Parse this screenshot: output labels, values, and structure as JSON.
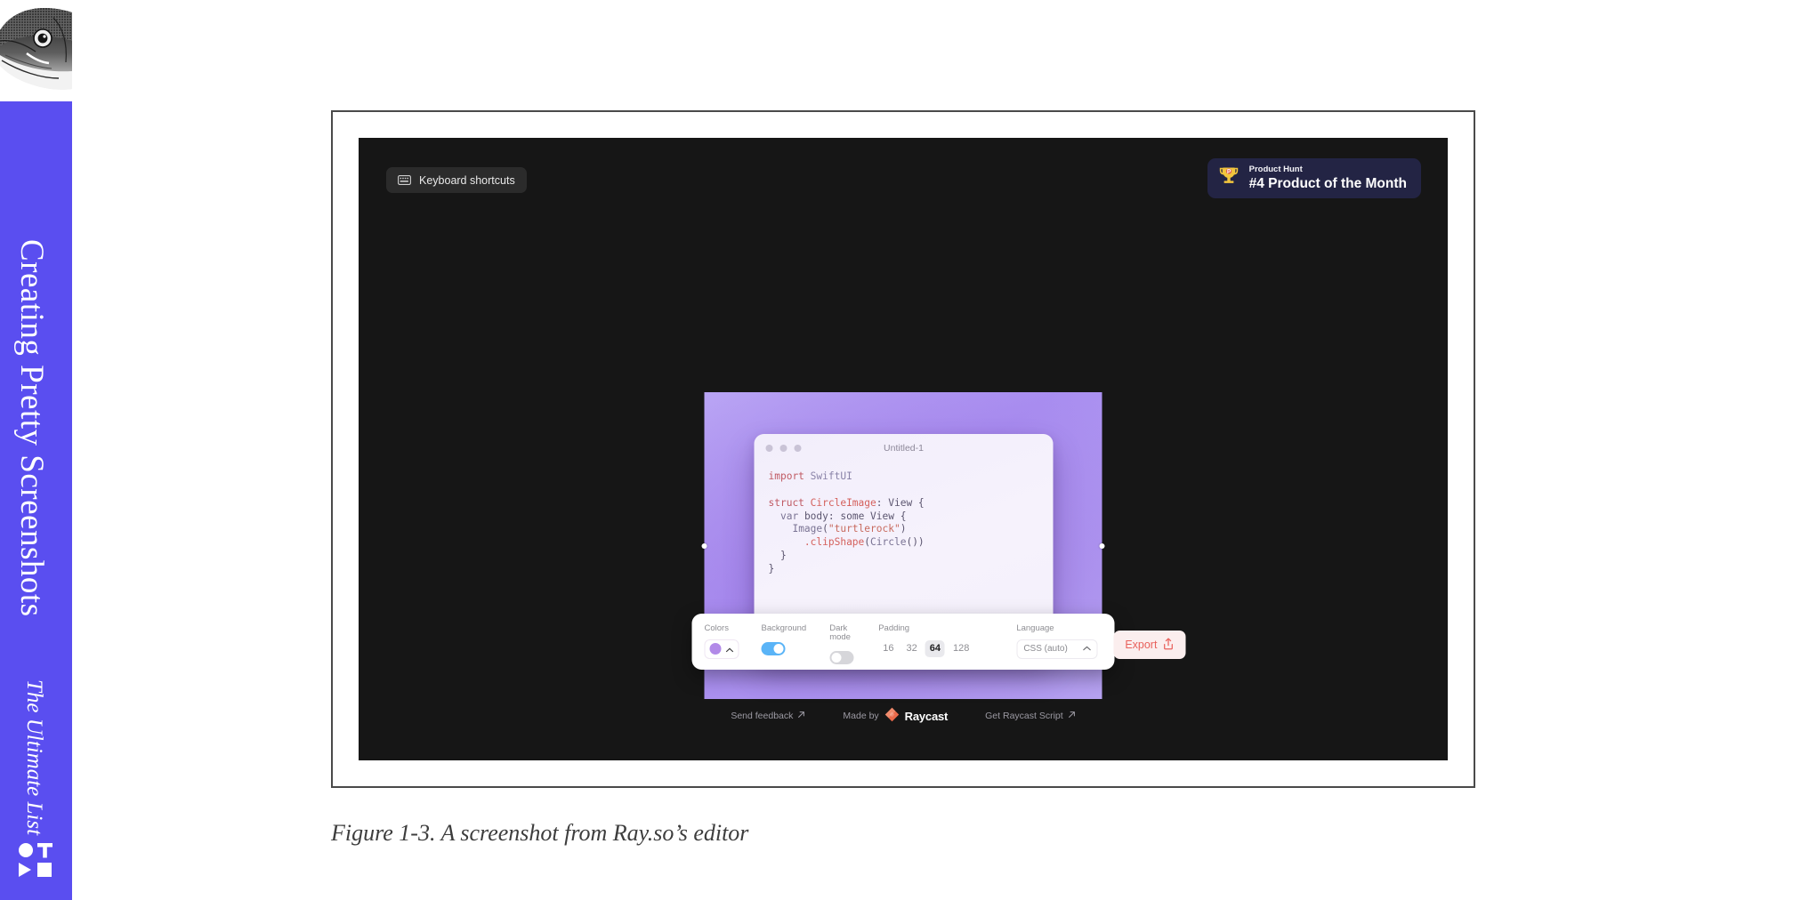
{
  "book": {
    "title": "Creating Pretty Screenshots",
    "subtitle": "The Ultimate List",
    "band_color": "#5a4ef0",
    "fish_icon": "fish-head-engraving-icon",
    "publisher_logo_icon": "publisher-shapes-logo-icon"
  },
  "caption": {
    "text": "Figure 1-3. A screenshot from Ray.so’s editor"
  },
  "app": {
    "background_color": "#161616",
    "keyboard_shortcuts": {
      "label": "Keyboard shortcuts",
      "icon": "keyboard-icon"
    },
    "product_hunt": {
      "label": "Product Hunt",
      "rank": "#4 Product of the Month",
      "icon": "trophy-icon",
      "badge_color": "#232444"
    }
  },
  "snippet": {
    "gradient_from": "#b9a4f4",
    "gradient_to": "#a98ef0",
    "window_title": "Untitled-1",
    "traffic_dots": [
      "dot-1",
      "dot-2",
      "dot-3"
    ],
    "code_lines": [
      [
        {
          "t": "import ",
          "c": "tok-kw"
        },
        {
          "t": "SwiftUI",
          "c": "tok-type"
        }
      ],
      [],
      [
        {
          "t": "struct ",
          "c": "tok-kw"
        },
        {
          "t": "CircleImage",
          "c": "tok-fn"
        },
        {
          "t": ": ",
          "c": "tok-pln"
        },
        {
          "t": "View",
          "c": "tok-pln"
        },
        {
          "t": " {",
          "c": "tok-pln"
        }
      ],
      [
        {
          "t": "  ",
          "c": "tok-pln"
        },
        {
          "t": "var",
          "c": "tok-id"
        },
        {
          "t": " body: ",
          "c": "tok-pln"
        },
        {
          "t": "some",
          "c": "tok-pln"
        },
        {
          "t": " View {",
          "c": "tok-pln"
        }
      ],
      [
        {
          "t": "    ",
          "c": "tok-pln"
        },
        {
          "t": "Image",
          "c": "tok-id"
        },
        {
          "t": "(",
          "c": "tok-pln"
        },
        {
          "t": "\"turtlerock\"",
          "c": "tok-str"
        },
        {
          "t": ")",
          "c": "tok-pln"
        }
      ],
      [
        {
          "t": "      ",
          "c": "tok-pln"
        },
        {
          "t": ".clipShape",
          "c": "tok-fn"
        },
        {
          "t": "(",
          "c": "tok-pln"
        },
        {
          "t": "Circle",
          "c": "tok-id"
        },
        {
          "t": "())",
          "c": "tok-pln"
        }
      ],
      [
        {
          "t": "  }",
          "c": "tok-pln"
        }
      ],
      [
        {
          "t": "}",
          "c": "tok-pln"
        }
      ]
    ]
  },
  "toolbar": {
    "colors": {
      "label": "Colors",
      "swatch_color": "#b28ae8",
      "chevron": "chevron-up-icon"
    },
    "background": {
      "label": "Background",
      "state": "on",
      "accent": "#5ab4f7"
    },
    "dark_mode": {
      "label": "Dark mode",
      "state": "off"
    },
    "padding": {
      "label": "Padding",
      "options": [
        "16",
        "32",
        "64",
        "128"
      ],
      "selected": "64"
    },
    "language": {
      "label": "Language",
      "value": "CSS (auto)",
      "chevron": "chevron-up-icon"
    },
    "export": {
      "label": "Export",
      "icon": "share-icon",
      "accent": "#e8615c"
    }
  },
  "footer": {
    "send_feedback": "Send feedback",
    "made_by": "Made by",
    "brand": "Raycast",
    "get_script": "Get Raycast Script",
    "external_icon": "external-link-arrow-icon"
  }
}
